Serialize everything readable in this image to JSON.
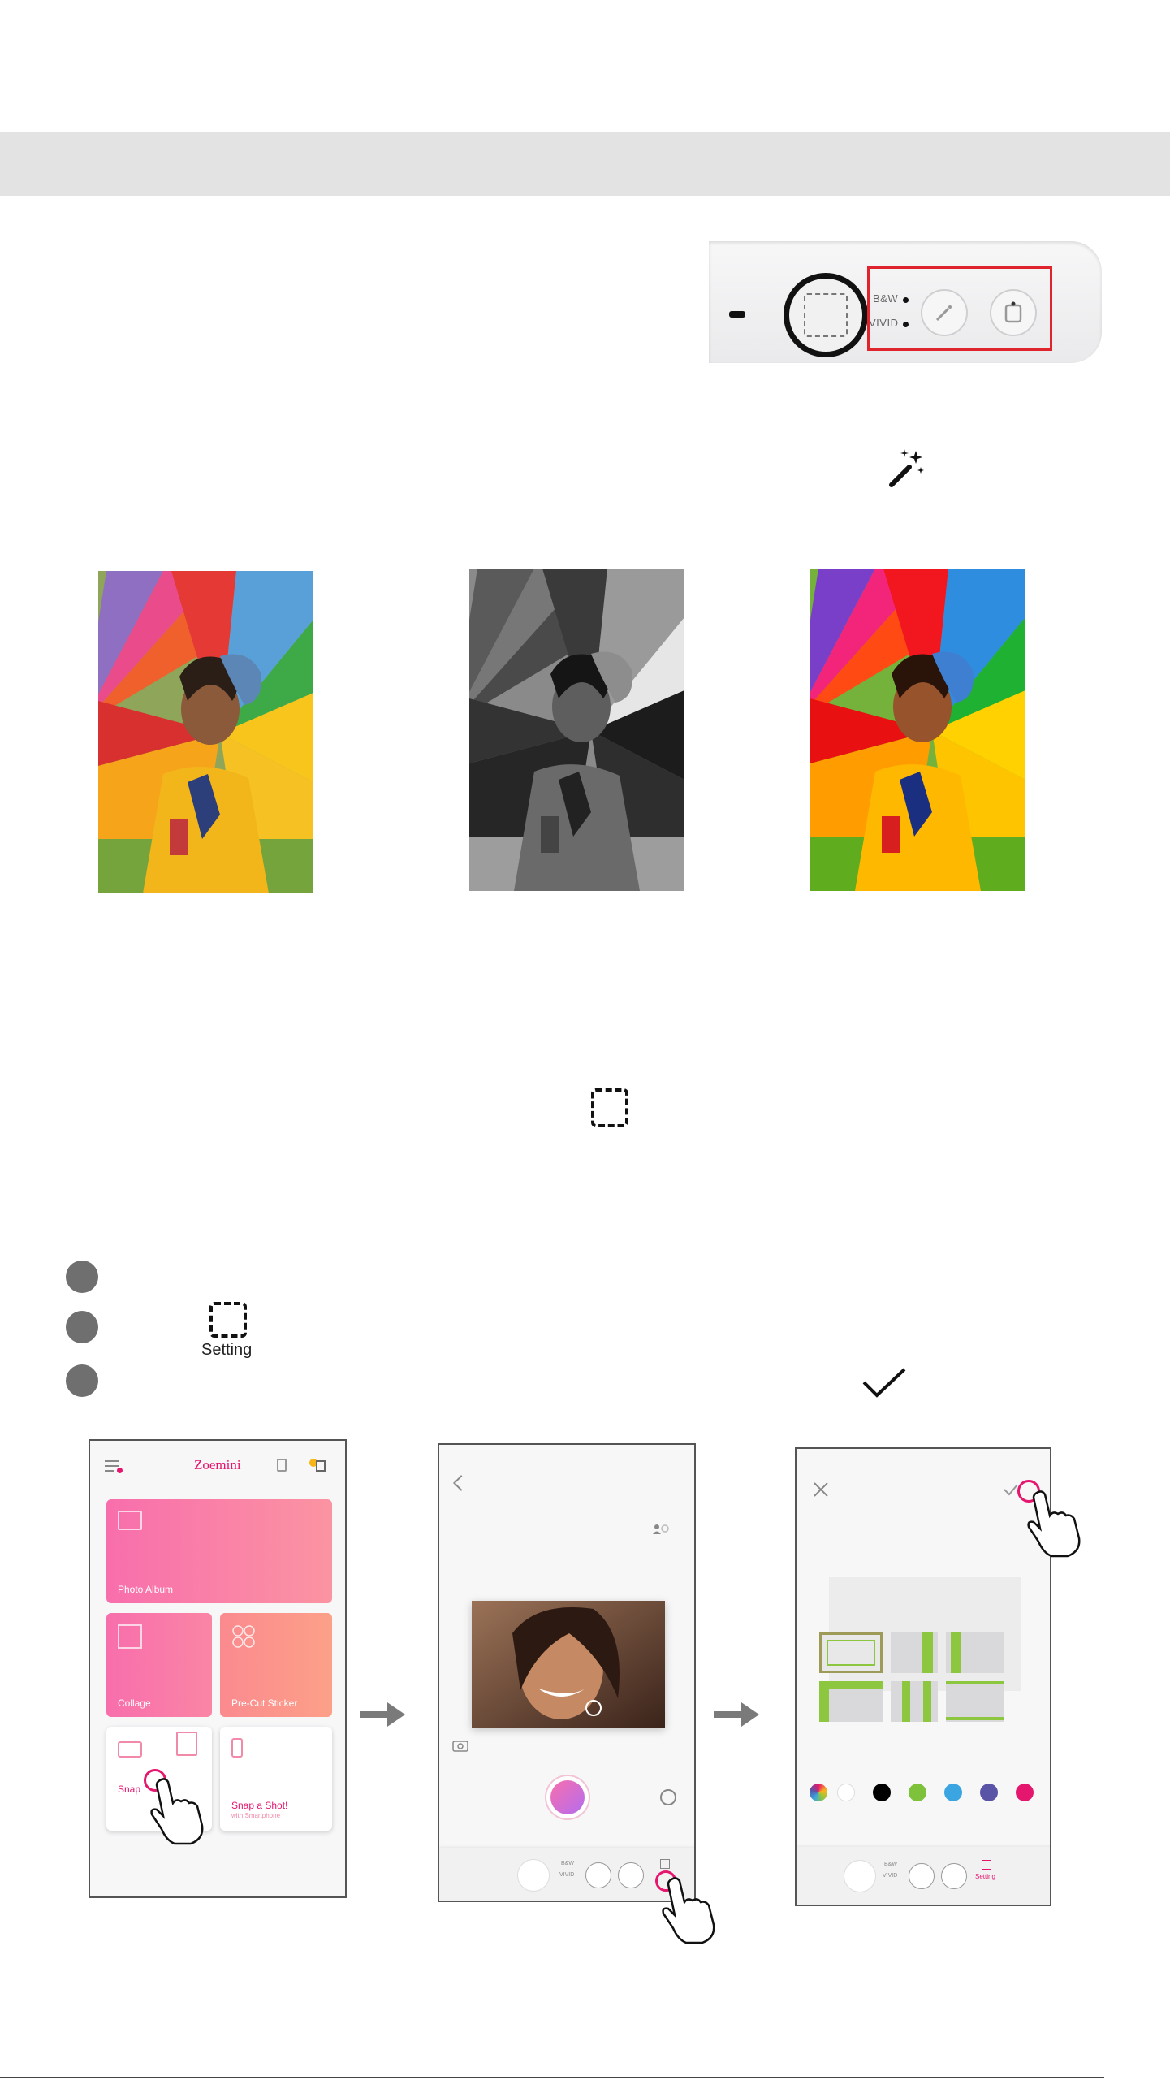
{
  "camera": {
    "bw_label": "B&W",
    "vivid_label": "VIVID"
  },
  "steps": [
    {
      "number": "",
      "text": ""
    },
    {
      "number": "",
      "text": "",
      "icon_label": "Setting"
    },
    {
      "number": "",
      "text": ""
    }
  ],
  "app_home": {
    "logo": "Zoemini",
    "tiles": {
      "photo_album": "Photo Album",
      "collage": "Collage",
      "precut": "Pre-Cut Sticker",
      "snap": "Snap",
      "snap_shot": "Snap a Shot!",
      "snap_shot_sub": "with Smartphone"
    }
  },
  "app_camera": {
    "bw_label": "B&W",
    "vivid_label": "VIVID",
    "setting_label": "Setting"
  },
  "app_setting": {
    "bw_label": "B&W",
    "vivid_label": "VIVID",
    "setting_label": "Setting",
    "colors": [
      "#ffffff",
      "#000000",
      "#7ec13b",
      "#3aa5e0",
      "#5a54a6",
      "#e5166e"
    ],
    "accent": "#8dc63f"
  }
}
